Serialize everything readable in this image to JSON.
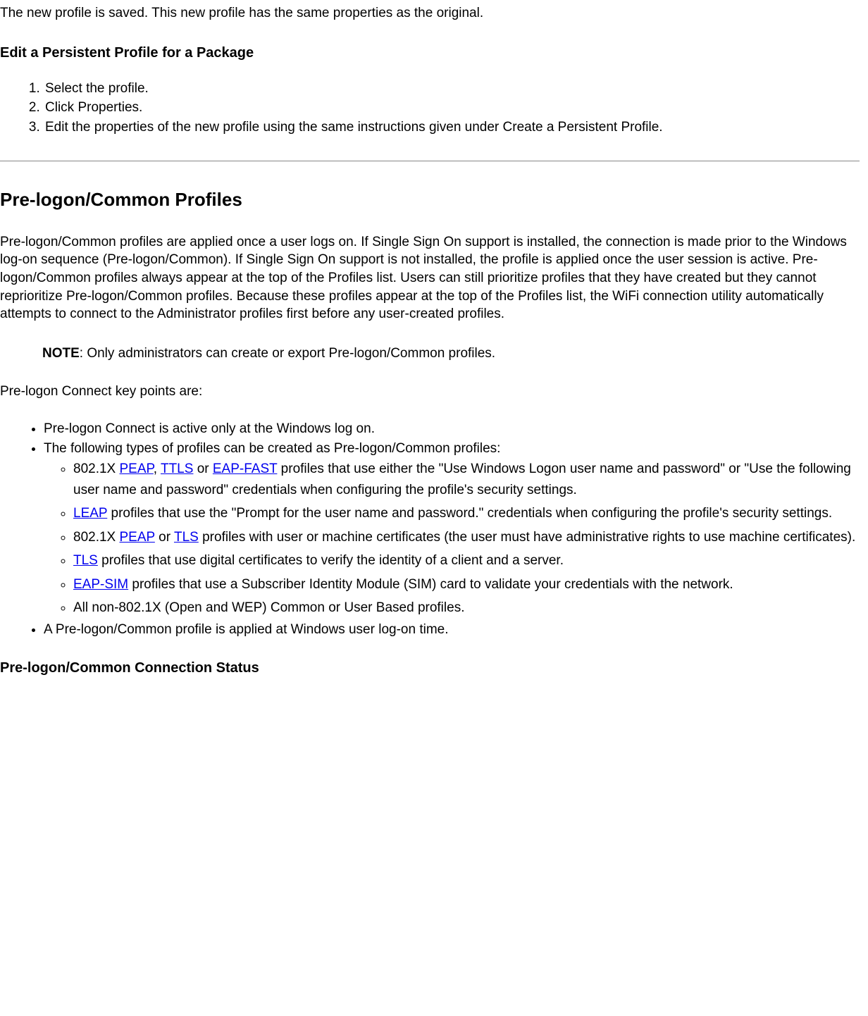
{
  "intro_sentence": "The new profile is saved. This new profile has the same properties as the original.",
  "heading_edit": "Edit a Persistent Profile for a Package",
  "steps": {
    "s1": "Select the profile.",
    "s2": "Click Properties.",
    "s3": "Edit the properties of the new profile using the same instructions given under Create a Persistent Profile."
  },
  "heading_prelogon": "Pre-logon/Common Profiles",
  "prelogon_para": "Pre-logon/Common profiles are applied once a user logs on. If Single Sign On support is installed, the connection is made prior to the Windows log-on sequence (Pre-logon/Common). If Single Sign On support is not installed, the profile is applied once the user session is active. Pre-logon/Common profiles always appear at the top of the Profiles list. Users can still prioritize profiles that they have created but they cannot reprioritize Pre-logon/Common profiles. Because these profiles appear at the top of the Profiles list, the WiFi connection utility automatically attempts to connect to the Administrator profiles first before any user-created profiles.",
  "note_label": "NOTE",
  "note_text": ": Only administrators can create or export Pre-logon/Common profiles.",
  "keypoints_intro": "Pre-logon Connect key points are:",
  "bullets": {
    "b1": "Pre-logon Connect is active only at the Windows log on.",
    "b2": "The following types of profiles can be created as Pre-logon/Common profiles:",
    "b3": "A Pre-logon/Common profile is applied at Windows user log-on time."
  },
  "sub": {
    "s1_pre": "802.1X ",
    "peap": "PEAP",
    "s1_mid1": ", ",
    "ttls": "TTLS",
    "s1_mid2": " or ",
    "eapfast": "EAP-FAST",
    "s1_post": " profiles that use either the \"Use Windows Logon user name and password\" or \"Use the following user name and password\" credentials when configuring the profile's security settings.",
    "leap": "LEAP",
    "s2_post": " profiles that use the \"Prompt for the user name and password.\" credentials when configuring the profile's security settings.",
    "s3_pre": "802.1X ",
    "s3_mid": " or ",
    "tls": "TLS",
    "s3_post": " profiles with user or machine certificates (the user must have administrative rights to use machine certificates).",
    "s4_post": " profiles that use digital certificates to verify the identity of a client and a server.",
    "eapsim": "EAP-SIM",
    "s5_post": " profiles that use a Subscriber Identity Module (SIM) card to validate your credentials with the network.",
    "s6": "All non-802.1X (Open and WEP) Common or User Based profiles."
  },
  "heading_status": "Pre-logon/Common Connection Status"
}
